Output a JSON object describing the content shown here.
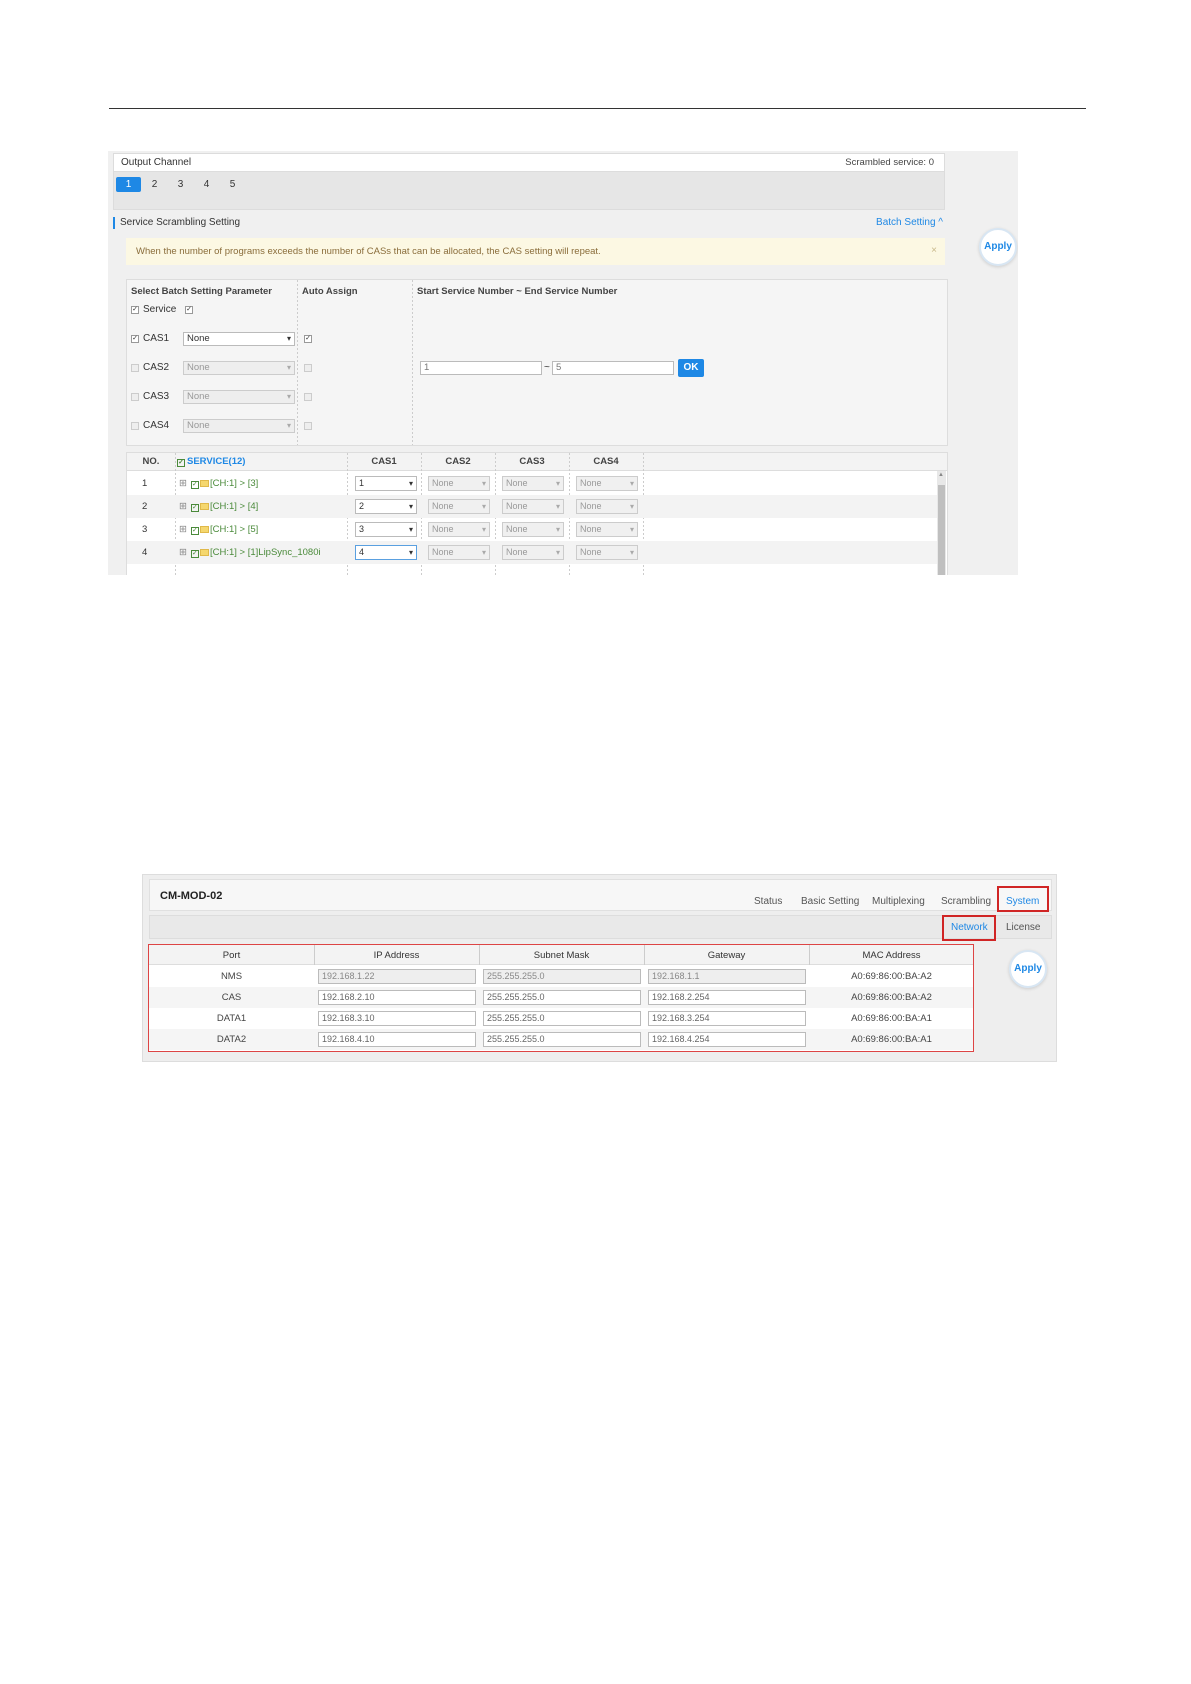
{
  "shot1": {
    "output_channel": {
      "title": "Output Channel",
      "scrambled_service": "Scrambled service: 0",
      "channels": [
        "1",
        "2",
        "3",
        "4",
        "5"
      ]
    },
    "section": {
      "title": "Service Scrambling Setting",
      "batch_link": "Batch Setting ^"
    },
    "apply_label": "Apply",
    "warning": {
      "text": "When the number of programs exceeds the number of CASs that can be allocated, the CAS setting will repeat.",
      "close": "×"
    },
    "batch": {
      "header_param": "Select Batch Setting Parameter",
      "header_auto": "Auto Assign",
      "header_range": "Start Service Number ~ End Service Number",
      "rows": [
        {
          "label": "Service",
          "checked": true
        },
        {
          "label": "CAS1",
          "select": "None",
          "auto": true,
          "checked": true
        },
        {
          "label": "CAS2",
          "select": "None",
          "auto": false,
          "checked": false
        },
        {
          "label": "CAS3",
          "select": "None",
          "auto": false,
          "checked": false
        },
        {
          "label": "CAS4",
          "select": "None",
          "auto": false,
          "checked": false
        }
      ],
      "start_value": "1",
      "tilde": "~",
      "end_value": "5",
      "ok_label": "OK"
    },
    "service_table": {
      "headers": [
        "NO.",
        "SERVICE(12)",
        "CAS1",
        "CAS2",
        "CAS3",
        "CAS4"
      ],
      "rows": [
        {
          "no": "1",
          "name": "[CH:1] > [3]",
          "cas1": "1",
          "cas2": "None",
          "cas3": "None",
          "cas4": "None"
        },
        {
          "no": "2",
          "name": "[CH:1] > [4]",
          "cas1": "2",
          "cas2": "None",
          "cas3": "None",
          "cas4": "None"
        },
        {
          "no": "3",
          "name": "[CH:1] > [5]",
          "cas1": "3",
          "cas2": "None",
          "cas3": "None",
          "cas4": "None"
        },
        {
          "no": "4",
          "name": "[CH:1] > [1]LipSync_1080i",
          "cas1": "4",
          "cas2": "None",
          "cas3": "None",
          "cas4": "None"
        }
      ]
    }
  },
  "shot2": {
    "brand": "CM-MOD-02",
    "nav": [
      "Status",
      "Basic Setting",
      "Multiplexing",
      "Scrambling",
      "System"
    ],
    "subnav": [
      "Network",
      "License"
    ],
    "apply_label": "Apply",
    "table": {
      "headers": [
        "Port",
        "IP Address",
        "Subnet Mask",
        "Gateway",
        "MAC Address"
      ],
      "rows": [
        {
          "port": "NMS",
          "ip": "192.168.1.22",
          "mask": "255.255.255.0",
          "gateway": "192.168.1.1",
          "mac": "A0:69:86:00:BA:A2"
        },
        {
          "port": "CAS",
          "ip": "192.168.2.10",
          "mask": "255.255.255.0",
          "gateway": "192.168.2.254",
          "mac": "A0:69:86:00:BA:A2"
        },
        {
          "port": "DATA1",
          "ip": "192.168.3.10",
          "mask": "255.255.255.0",
          "gateway": "192.168.3.254",
          "mac": "A0:69:86:00:BA:A1"
        },
        {
          "port": "DATA2",
          "ip": "192.168.4.10",
          "mask": "255.255.255.0",
          "gateway": "192.168.4.254",
          "mac": "A0:69:86:00:BA:A1"
        }
      ]
    }
  }
}
